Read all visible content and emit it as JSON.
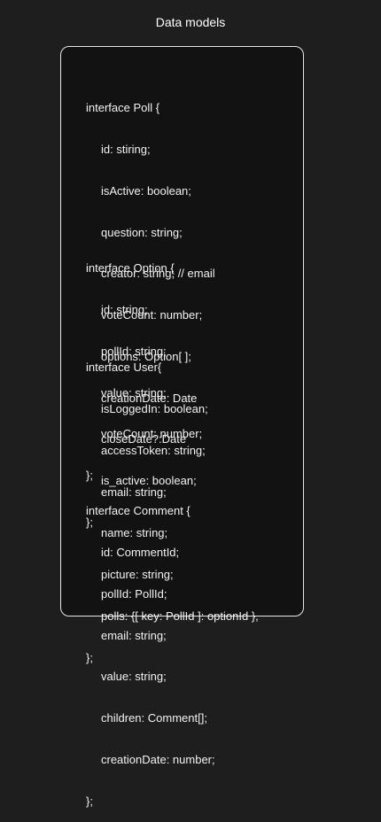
{
  "title": "Data models",
  "interfaces": [
    {
      "header": "interface Poll {",
      "fields": [
        "id: stiring;",
        "isActive: boolean;",
        "question: string;",
        "creator: string; // email",
        "voteCount: number;",
        "options: Option[ ];",
        "creationDate: Date",
        "closeDate?:Date",
        "is_active: boolean;"
      ],
      "footer": "};"
    },
    {
      "header": "interface Option {",
      "fields": [
        "id: string;",
        "pollId: string;",
        "value: string;",
        "voteCount: number;"
      ],
      "footer": "};"
    },
    {
      "header": "interface User{",
      "fields": [
        "isLoggedIn: boolean;",
        "accessToken: string;",
        "email: string;",
        "name: string;",
        "picture: string;",
        "polls: {[ key: PollId ]: optionId },"
      ],
      "footer": "};"
    },
    {
      "header": "interface Comment {",
      "fields": [
        "id: CommentId;",
        "pollId: PollId;",
        "email: string;",
        "value: string;",
        "children: Comment[];",
        "creationDate: number;"
      ],
      "footer": "};"
    }
  ]
}
